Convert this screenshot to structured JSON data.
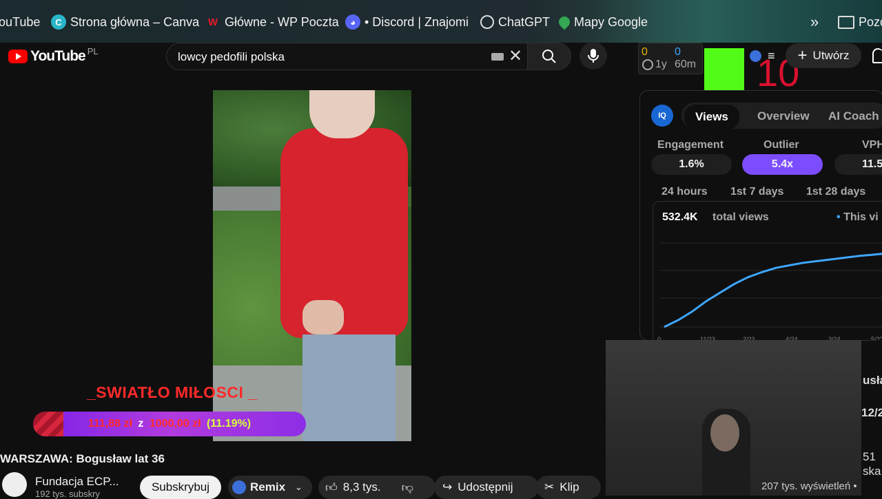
{
  "bookmarks": {
    "items": [
      {
        "label": "ouTube",
        "icon": "youtube-icon"
      },
      {
        "label": "Strona główna – Canva",
        "icon": "canva-icon"
      },
      {
        "label": "Główne - WP Poczta",
        "icon": "wp-icon"
      },
      {
        "label": "• Discord | Znajomi",
        "icon": "discord-icon"
      },
      {
        "label": "ChatGPT",
        "icon": "chatgpt-icon"
      },
      {
        "label": "Mapy Google",
        "icon": "maps-icon"
      }
    ],
    "overflow_icon": "double-chevron-icon",
    "folder_label": "Pozo"
  },
  "header": {
    "logo_text": "YouTube",
    "country_code": "PL",
    "search_value": "lowcy pedofili polska",
    "create_label": "Utwórz"
  },
  "extension": {
    "top_left": "0",
    "top_right": "0",
    "bottom_left": "1y",
    "bottom_right": "60m",
    "kick_count": "10"
  },
  "video_overlay": {
    "title": "_SWIATŁO MIŁOSCI _",
    "raised": "111,88 zł",
    "separator": "z",
    "goal": "1000,00 zł",
    "percent_text": "(11.19%)",
    "progress_fraction": 0.1119
  },
  "video": {
    "title": "WARSZAWA: Bogusław lat 36",
    "channel": "Fundacja ECP...",
    "subscribers": "192 tys. subskry",
    "subscribe_label": "Subskrybuj",
    "remix_label": "Remix",
    "likes": "8,3 tys.",
    "share_label": "Udostępnij",
    "clip_label": "Klip"
  },
  "vidiq": {
    "logo": "IQ",
    "tabs": [
      "Views",
      "Overview",
      "AI Coach"
    ],
    "active_tab": "Views",
    "metrics": [
      {
        "label": "Engagement",
        "value": "1.6%"
      },
      {
        "label": "Outlier",
        "value": "5.4x"
      },
      {
        "label": "VPH",
        "value": "11.5"
      }
    ],
    "periods": [
      "24 hours",
      "1st 7 days",
      "1st 28 days"
    ],
    "total_views": "532.4K",
    "total_views_label": "total views",
    "legend_label": "This vi",
    "colors": {
      "accent": "#7c4dff",
      "line": "#3ea6ff"
    }
  },
  "chart_data": {
    "type": "line",
    "title": "",
    "xlabel": "",
    "ylabel": "",
    "x_tick_labels": [
      "0",
      "11/23",
      "2/22",
      "4/24",
      "3/24",
      "5/25"
    ],
    "series": [
      {
        "name": "This video",
        "values": [
          0,
          40,
          90,
          150,
          200,
          250,
          290,
          320,
          345,
          360,
          375,
          385,
          395,
          405,
          415,
          422,
          430
        ]
      }
    ]
  },
  "right_edge": {
    "frag1": "usła",
    "frag2": "12/2",
    "frag3": "51",
    "frag4": "ska:",
    "views_frag": "207 tys. wyświetleń •"
  }
}
